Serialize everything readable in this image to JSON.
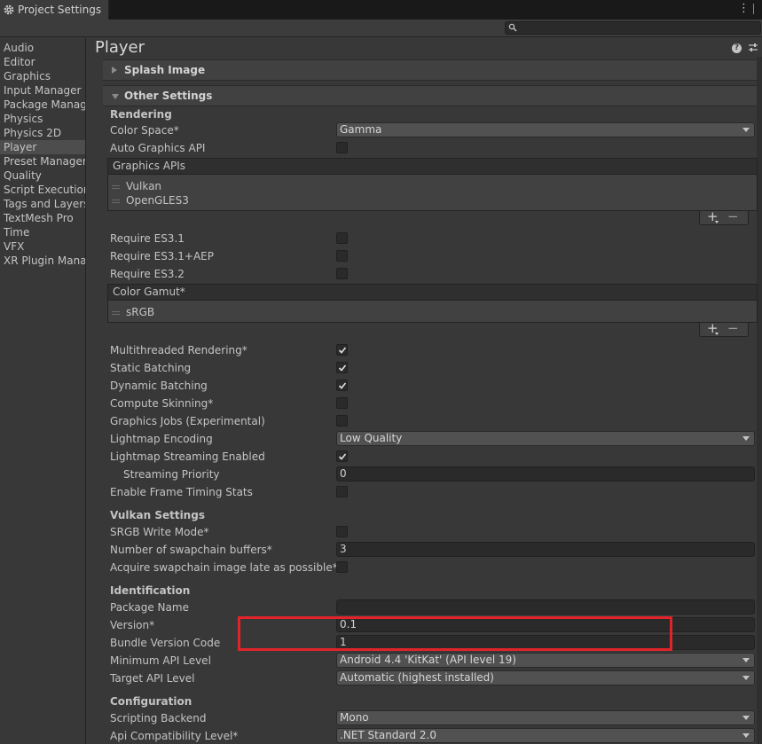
{
  "window": {
    "tab_title": "Project Settings"
  },
  "search": {
    "placeholder": ""
  },
  "sidebar": {
    "items": [
      {
        "label": "Audio"
      },
      {
        "label": "Editor"
      },
      {
        "label": "Graphics"
      },
      {
        "label": "Input Manager"
      },
      {
        "label": "Package Manager"
      },
      {
        "label": "Physics"
      },
      {
        "label": "Physics 2D"
      },
      {
        "label": "Player",
        "active": true
      },
      {
        "label": "Preset Manager"
      },
      {
        "label": "Quality"
      },
      {
        "label": "Script Execution Order"
      },
      {
        "label": "Tags and Layers"
      },
      {
        "label": "TextMesh Pro"
      },
      {
        "label": "Time"
      },
      {
        "label": "VFX"
      },
      {
        "label": "XR Plugin Management"
      }
    ]
  },
  "main": {
    "title": "Player",
    "splash_image": "Splash Image",
    "other_settings": "Other Settings",
    "rendering": {
      "header": "Rendering",
      "color_space": {
        "label": "Color Space*",
        "value": "Gamma"
      },
      "auto_graphics_api": {
        "label": "Auto Graphics API",
        "checked": false
      },
      "graphics_apis": {
        "header": "Graphics APIs",
        "items": [
          "Vulkan",
          "OpenGLES3"
        ]
      },
      "require_es31": {
        "label": "Require ES3.1",
        "checked": false
      },
      "require_es31_aep": {
        "label": "Require ES3.1+AEP",
        "checked": false
      },
      "require_es32": {
        "label": "Require ES3.2",
        "checked": false
      },
      "color_gamut": {
        "header": "Color Gamut*",
        "items": [
          "sRGB"
        ]
      },
      "multithreaded_rendering": {
        "label": "Multithreaded Rendering*",
        "checked": true
      },
      "static_batching": {
        "label": "Static Batching",
        "checked": true
      },
      "dynamic_batching": {
        "label": "Dynamic Batching",
        "checked": true
      },
      "compute_skinning": {
        "label": "Compute Skinning*",
        "checked": false
      },
      "graphics_jobs": {
        "label": "Graphics Jobs (Experimental)",
        "checked": false
      },
      "lightmap_encoding": {
        "label": "Lightmap Encoding",
        "value": "Low Quality"
      },
      "lightmap_streaming": {
        "label": "Lightmap Streaming Enabled",
        "checked": true
      },
      "streaming_priority": {
        "label": "Streaming Priority",
        "value": "0"
      },
      "frame_timing_stats": {
        "label": "Enable Frame Timing Stats",
        "checked": false
      }
    },
    "vulkan": {
      "header": "Vulkan Settings",
      "srgb_write_mode": {
        "label": "SRGB Write Mode*",
        "checked": false
      },
      "swapchain_buffers": {
        "label": "Number of swapchain buffers*",
        "value": "3"
      },
      "acquire_late": {
        "label": "Acquire swapchain image late as possible*",
        "checked": false
      }
    },
    "identification": {
      "header": "Identification",
      "package_name": {
        "label": "Package Name",
        "value": ""
      },
      "version": {
        "label": "Version*",
        "value": "0.1"
      },
      "bundle_version_code": {
        "label": "Bundle Version Code",
        "value": "1"
      },
      "min_api": {
        "label": "Minimum API Level",
        "value": "Android 4.4 'KitKat' (API level 19)"
      },
      "target_api": {
        "label": "Target API Level",
        "value": "Automatic (highest installed)"
      }
    },
    "configuration": {
      "header": "Configuration",
      "scripting_backend": {
        "label": "Scripting Backend",
        "value": "Mono"
      },
      "api_compat": {
        "label": "Api Compatibility Level*",
        "value": ".NET Standard 2.0"
      }
    }
  },
  "colors": {
    "highlight": "#e2232a",
    "background": "#383838"
  }
}
